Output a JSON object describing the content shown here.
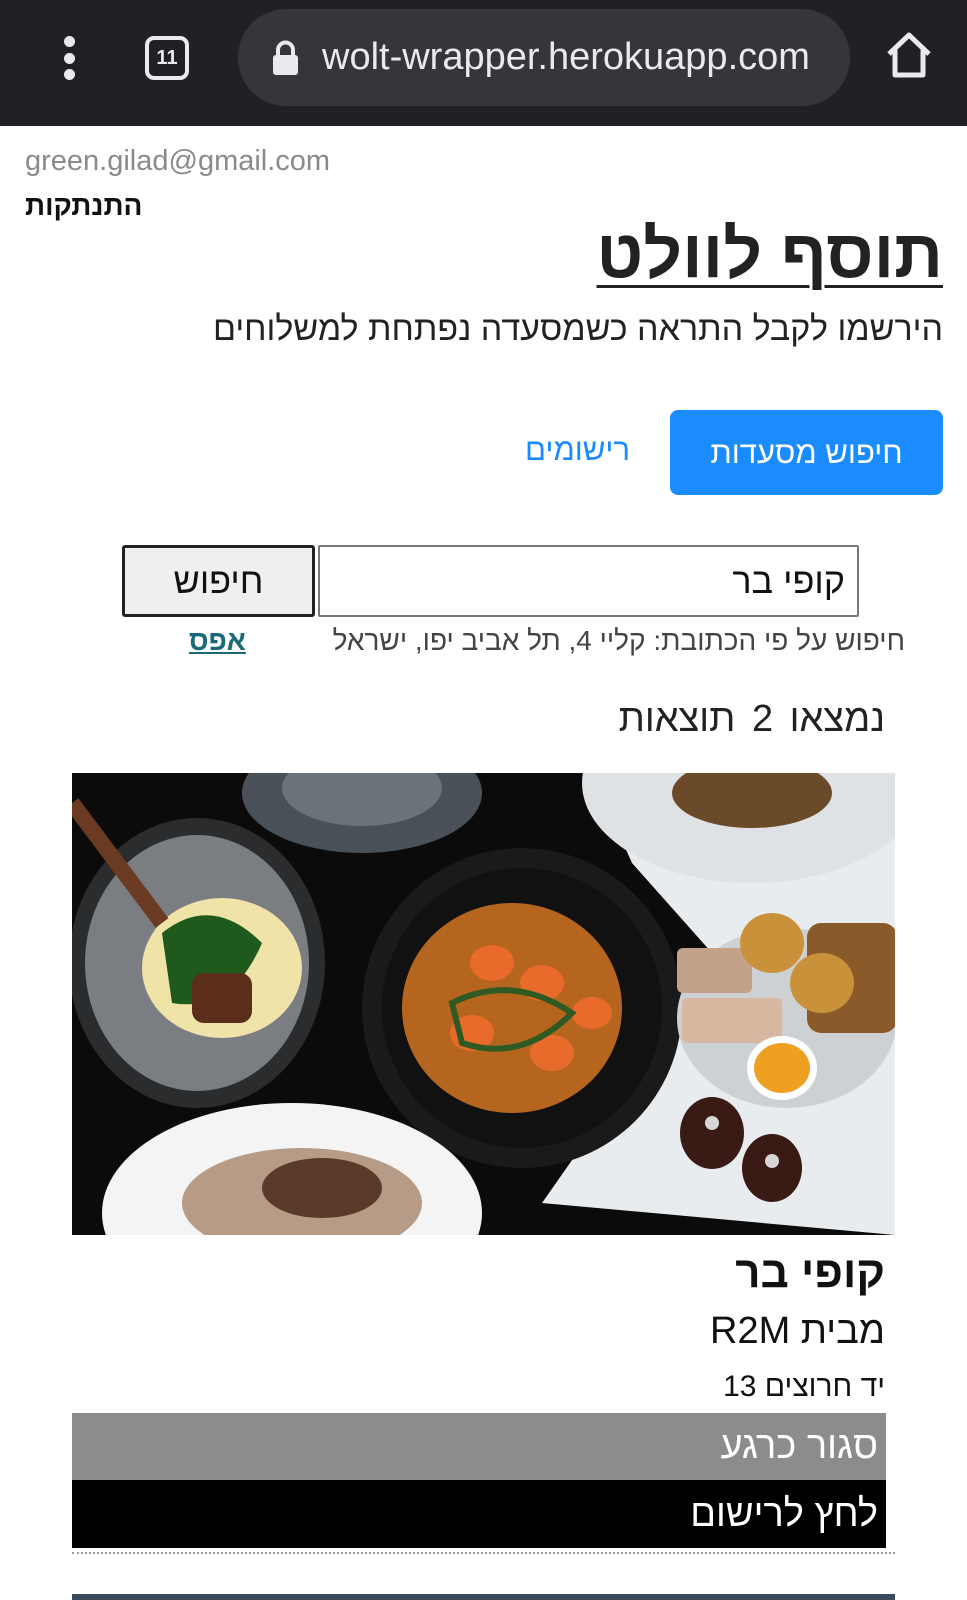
{
  "browser": {
    "tab_count": "11",
    "url": "wolt-wrapper.herokuapp.com"
  },
  "user": {
    "email": "green.gilad@gmail.com",
    "logout_label": "התנתקות"
  },
  "header": {
    "title": "תוסף לוולט",
    "subtitle": "הירשמו לקבל התראה כשמסעדה נפתחת למשלוחים"
  },
  "nav": {
    "search_restaurants_label": "חיפוש מסעדות",
    "subscriptions_label": "רישומים"
  },
  "search": {
    "value": "קופי בר",
    "button_label": "חיפוש",
    "address_text": "חיפוש על פי הכתובת: קליי 4, תל אביב יפו, ישראל",
    "reset_label": "אפס"
  },
  "results": {
    "count_text": "נמצאו 2 תוצאות",
    "items": [
      {
        "name": "קופי בר",
        "source": "מבית R2M",
        "address": "יד חרוצים 13",
        "status": "סגור כרגע",
        "register_label": "לחץ לרישום"
      }
    ]
  },
  "colors": {
    "chrome_bg": "#202124",
    "primary_blue": "#1a8cff",
    "status_gray": "#8c8c8c",
    "register_black": "#000000",
    "reset_link": "#196a7a"
  }
}
